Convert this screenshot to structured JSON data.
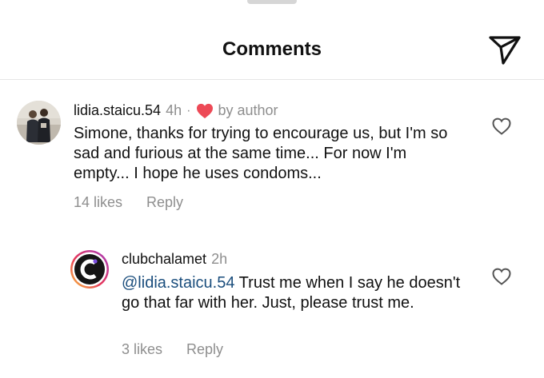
{
  "header": {
    "title": "Comments",
    "share_icon": "paper-plane-icon"
  },
  "colors": {
    "heart": "#ed4956",
    "mention": "#1b4e7d",
    "muted": "#8e8e8e"
  },
  "comments": [
    {
      "username": "lidia.staicu.54",
      "time": "4h",
      "separator": "·",
      "badge_icon": "heart-icon",
      "badge_text": "by author",
      "text": "Simone, thanks for trying to encourage us, but I'm so sad and furious at the same time... For now I'm empty... I hope he uses condoms...",
      "likes": "14 likes",
      "reply": "Reply"
    },
    {
      "username": "clubchalamet",
      "time": "2h",
      "mention": "@lidia.staicu.54",
      "text": " Trust me when I say he doesn't go that far with her. Just, please trust me.",
      "likes": "3 likes",
      "reply": "Reply"
    }
  ]
}
